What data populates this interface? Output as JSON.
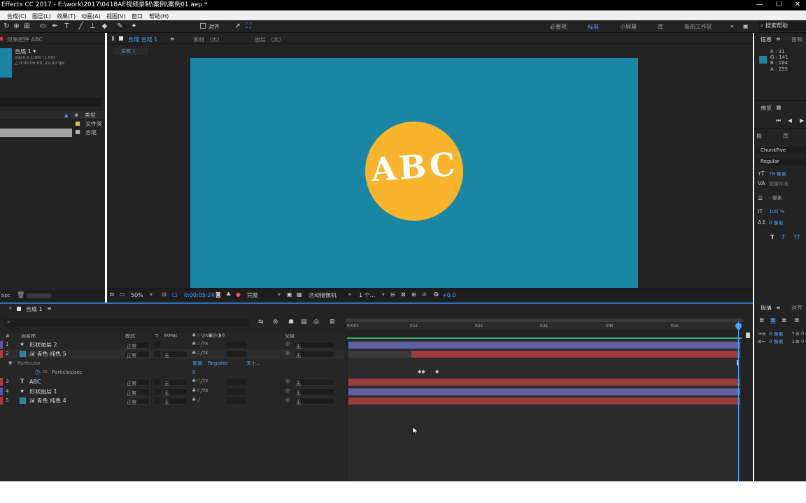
{
  "app": {
    "title": "Effects CC 2017 - E:\\work\\2017\\0418AE视频录制\\案例\\案例01.aep *"
  },
  "menu": {
    "items": [
      "合成(C)",
      "图层(L)",
      "效果(T)",
      "动画(A)",
      "视图(V)",
      "窗口",
      "帮助(H)"
    ]
  },
  "toolbar": {
    "align_label": "对齐",
    "workspaces": [
      "必要项",
      "标准",
      "小屏幕",
      "库",
      "新的工作区"
    ],
    "search_placeholder": "搜索帮助"
  },
  "project_panel": {
    "tab_label": "效果控件 ABC",
    "comp_name": "合成 1 ▾",
    "comp_resolution": "1920 x 1080 (1.00)",
    "comp_duration": "△ 0:00:06:00, 25.00 fps",
    "col_type": "类型",
    "rows": [
      {
        "type": "文件夹"
      },
      {
        "type": "合成"
      }
    ],
    "bpc_label": "bpc"
  },
  "composition": {
    "tab_label": "合成 合成 1",
    "footage_tab": "素材 （无）",
    "layer_tab": "图层 （无）",
    "breadcrumb": "合成 1",
    "canvas_color": "#1a86a6",
    "circle_color": "#f7b42c",
    "canvas_text": "ABC",
    "footer": {
      "zoom": "50%",
      "timecode": "0:00:05:24",
      "quality": "完整",
      "camera": "活动摄像机",
      "views": "1 个...",
      "exposure": "+0.0"
    }
  },
  "info_panel": {
    "tab_info": "信息",
    "tab_audio": "音频",
    "swatch_color": "#1a86a6",
    "r": "R : 31",
    "g": "G : 141",
    "b": "B : 164",
    "a": "A : 255",
    "preview_tab": "预览"
  },
  "character_panel": {
    "tab_left": "段",
    "tab_right": "库",
    "font": "ChunkFive",
    "style": "Regular",
    "size": "78 像素",
    "kerning": "度量标准",
    "leading": "- 像素",
    "scale": "100 %",
    "baseline": "0 像素"
  },
  "paragraph_panel": {
    "tab_paragraph": "段落",
    "tab_align": "对齐",
    "indent_left": "0 像素",
    "indent_right": "0 像素",
    "space_before": "0",
    "space_after": "0"
  },
  "timeline": {
    "tab_label": "合成 1",
    "columns": {
      "num": "#",
      "source_name": "源名称",
      "mode": "模式",
      "t": "T",
      "trkmat": "TrkMat",
      "parent": "父级"
    },
    "ruler": [
      "0:00s",
      "01s",
      "02s",
      "03s",
      "04s",
      "05s"
    ],
    "layers": [
      {
        "num": "1",
        "icon": "star-icon",
        "name": "形状图层 2",
        "mode": "正常",
        "trkmat": "",
        "parent": "无",
        "color": "#5a5aa8",
        "bar_color": "#5f63a6"
      },
      {
        "num": "2",
        "icon": "solid-icon",
        "name": "深 青色 纯色 5",
        "mode": "正常",
        "trkmat": "无",
        "parent": "无",
        "color": "#b23a3a",
        "bar_color": "#9c3c3c"
      },
      {
        "num": "3",
        "icon": "text-icon",
        "name": "ABC",
        "mode": "正常",
        "trkmat": "无",
        "parent": "无",
        "color": "#b23a3a",
        "bar_color": "#9c3c3c"
      },
      {
        "num": "4",
        "icon": "star-icon",
        "name": "形状图层 1",
        "mode": "正常",
        "trkmat": "无",
        "parent": "无",
        "color": "#5a5aa8",
        "bar_color": "#5f63a6"
      },
      {
        "num": "5",
        "icon": "solid-icon",
        "name": "深 青色 纯色 4",
        "mode": "正常",
        "trkmat": "无",
        "parent": "无",
        "color": "#b23a3a",
        "bar_color": "#9c3c3c"
      }
    ],
    "effect": {
      "name": "Particular",
      "reset": "重置",
      "register": "Register",
      "about": "关于...",
      "prop_name": "Particles/sec",
      "prop_value": "0"
    }
  }
}
